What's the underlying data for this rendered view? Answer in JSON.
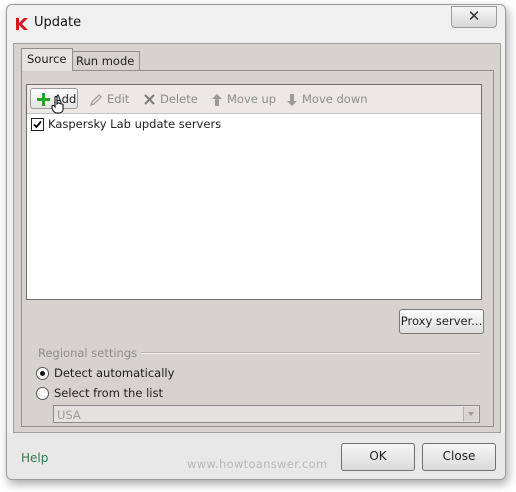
{
  "window": {
    "title": "Update",
    "app_icon": "kaspersky-k-icon",
    "close_glyph": "✕"
  },
  "tabs": [
    {
      "label": "Source",
      "active": true
    },
    {
      "label": "Run mode",
      "active": false
    }
  ],
  "toolbar": {
    "add": {
      "label": "Add",
      "icon": "plus-icon",
      "enabled": true
    },
    "edit": {
      "label": "Edit",
      "icon": "pencil-icon",
      "enabled": false
    },
    "delete": {
      "label": "Delete",
      "icon": "x-icon",
      "enabled": false
    },
    "move_up": {
      "label": "Move up",
      "icon": "arrow-up-icon",
      "enabled": false
    },
    "move_down": {
      "label": "Move down",
      "icon": "arrow-down-icon",
      "enabled": false
    }
  },
  "sources": [
    {
      "label": "Kaspersky Lab update servers",
      "checked": true
    }
  ],
  "proxy_button": "Proxy server...",
  "regional": {
    "group_label": "Regional settings",
    "options": [
      {
        "label": "Detect automatically",
        "selected": true
      },
      {
        "label": "Select from the list",
        "selected": false
      }
    ],
    "country_value": "USA",
    "country_enabled": false
  },
  "footer": {
    "help": "Help",
    "watermark": "www.howtoanswer.com",
    "ok": "OK",
    "close": "Close"
  },
  "colors": {
    "help_link": "#2d7a4c",
    "add_icon": "#2aa12a",
    "kaspersky_red": "#d11a1a"
  }
}
